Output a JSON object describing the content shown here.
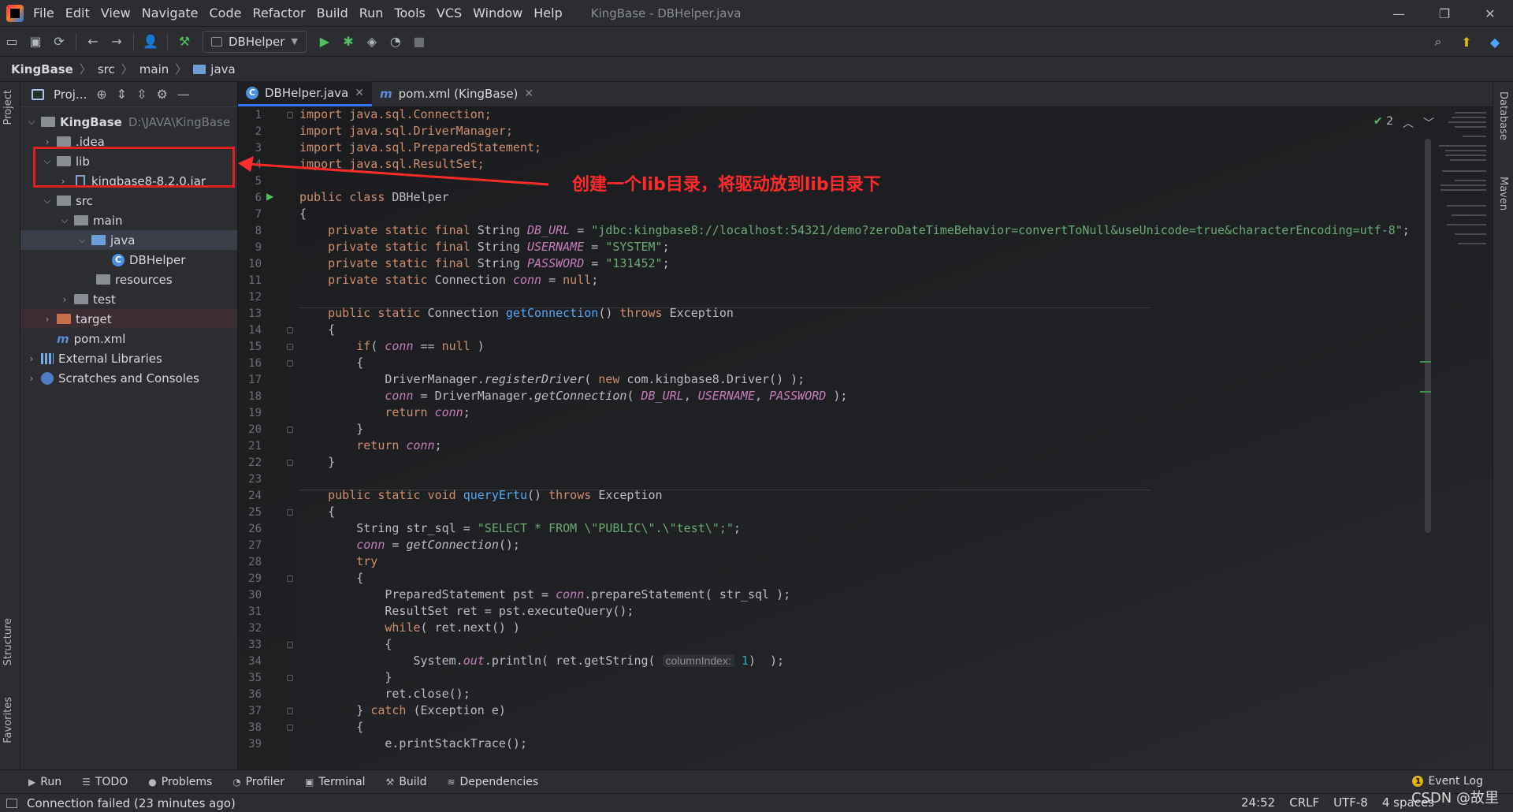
{
  "menu": {
    "items": [
      "File",
      "Edit",
      "View",
      "Navigate",
      "Code",
      "Refactor",
      "Build",
      "Run",
      "Tools",
      "VCS",
      "Window",
      "Help"
    ],
    "window_title": "KingBase - DBHelper.java"
  },
  "toolbar": {
    "run_config": "DBHelper"
  },
  "breadcrumb": {
    "project": "KingBase",
    "src": "src",
    "main": "main",
    "java": "java"
  },
  "side_tabs": {
    "project": "Project",
    "structure": "Structure",
    "favorites": "Favorites",
    "database": "Database",
    "maven": "Maven"
  },
  "project_panel": {
    "title": "Proj...",
    "root_name": "KingBase",
    "root_path": "D:\\JAVA\\KingBase",
    "idea": ".idea",
    "lib": "lib",
    "jar": "kingbase8-8.2.0.jar",
    "src": "src",
    "main": "main",
    "java": "java",
    "dbhelper": "DBHelper",
    "resources": "resources",
    "test": "test",
    "target": "target",
    "pom": "pom.xml",
    "external_libraries": "External Libraries",
    "scratches": "Scratches and Consoles"
  },
  "tabs": {
    "active": "DBHelper.java",
    "second": "pom.xml (KingBase)"
  },
  "inspection": {
    "count": "2"
  },
  "code": {
    "l1": "import java.sql.Connection;",
    "l2": "import java.sql.DriverManager;",
    "l3": "import java.sql.PreparedStatement;",
    "l4": "import java.sql.ResultSet;",
    "l6_kw": "public class",
    "l6_name": " DBHelper",
    "l7": "{",
    "psf": "private static final",
    "string_type": " String ",
    "db_url_name": "DB_URL",
    "db_url_value": "\"jdbc:kingbase8://localhost:54321/demo?zeroDateTimeBehavior=convertToNull&useUnicode=true&characterEncoding=utf-8\"",
    "username_name": "USERNAME",
    "username_value": "\"SYSTEM\"",
    "password_name": "PASSWORD",
    "password_value": "\"131452\"",
    "ps": "private static",
    "conn_type": " Connection ",
    "conn": "conn",
    "null_kw": "null",
    "pub_static": "public static",
    "get_conn_method": "getConnection",
    "throws_kw": "throws",
    "exception": "Exception",
    "if_kw": "if",
    "register_driver": "registerDriver",
    "new_kw": "new",
    "driver_class": " com.kingbase8.Driver() );",
    "get_connection_static": "getConnection",
    "return_kw": "return",
    "void_kw": "void",
    "query_method": "queryErtu",
    "sql_value": "\"SELECT * FROM \\\"PUBLIC\\\".\\\"test\\\";\"",
    "try_kw": "try",
    "prepare_stmt": "prepareStatement",
    "result_set": "ResultSet ret = pst.executeQuery();",
    "while_kw": "while",
    "while_cond": "( ret.next() )",
    "out_field": "out",
    "column_hint": "columnIndex:",
    "one": "1",
    "ret_close": "ret.close();",
    "catch_kw": "catch",
    "catch_param": " (Exception e)",
    "print_stack": "e.printStackTrace();"
  },
  "annotation": {
    "text": "创建一个lib目录，将驱动放到lib目录下",
    "color": "#ff2a2a"
  },
  "bottom_tabs": [
    "Run",
    "TODO",
    "Problems",
    "Profiler",
    "Terminal",
    "Build",
    "Dependencies"
  ],
  "event_log": "Event Log",
  "status": {
    "message": "Connection failed (23 minutes ago)",
    "position": "24:52",
    "line_sep": "CRLF",
    "encoding": "UTF-8",
    "indent": "4 spaces"
  },
  "watermark": "CSDN @故里",
  "colors": {
    "accent": "#3574f0",
    "keyword": "#cf8e6d",
    "string": "#6aab73",
    "field": "#c77dbb",
    "highlight_box": "#e02020"
  }
}
